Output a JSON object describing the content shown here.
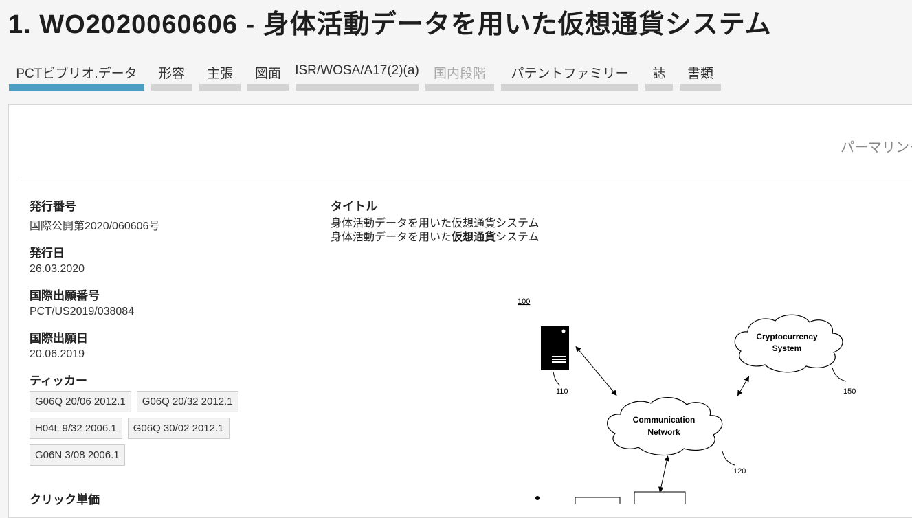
{
  "page": {
    "title": "1. WO2020060606 - 身体活動データを用いた仮想通貨システム"
  },
  "tabs": [
    {
      "label": "PCTビブリオ.データ",
      "state": "active"
    },
    {
      "label": "形容",
      "state": "normal"
    },
    {
      "label": "主張",
      "state": "normal"
    },
    {
      "label": "図面",
      "state": "normal"
    },
    {
      "label": "ISR/WOSA/A17(2)(a)",
      "state": "normal"
    },
    {
      "label": "国内段階",
      "state": "disabled"
    },
    {
      "label": "パテントファミリー",
      "state": "normal"
    },
    {
      "label": "誌",
      "state": "normal"
    },
    {
      "label": "書類",
      "state": "normal"
    }
  ],
  "permalink": "パーマリンク",
  "biblio": {
    "pub_number_label": "発行番号",
    "pub_number": "国際公開第2020/060606号",
    "pub_date_label": "発行日",
    "pub_date": "26.03.2020",
    "app_number_label": "国際出願番号",
    "app_number": "PCT/US2019/038084",
    "app_date_label": "国際出願日",
    "app_date": "20.06.2019",
    "ipc_label": "ティッカー",
    "ipc": [
      "G06Q 20/06 2012.1",
      "G06Q 20/32 2012.1",
      "H04L 9/32 2006.1",
      "G06Q 30/02 2012.1",
      "G06N 3/08 2006.1"
    ],
    "next_label": "クリック単価"
  },
  "title_section": {
    "label": "タイトル",
    "line1": "身体活動データを用いた仮想通貨システム",
    "line2_pre": "身体活動データを用いた",
    "line2_bold": "仮想通貨",
    "line2_post": "システム"
  },
  "drawing": {
    "ref_100": "100",
    "ref_110": "110",
    "ref_120": "120",
    "ref_150": "150",
    "crypto_line1": "Cryptocurrency",
    "crypto_line2": "System",
    "network_line1": "Communication",
    "network_line2": "Network"
  },
  "colors": {
    "active_tab": "#4a9fc1",
    "inactive_tab": "#d3d3d3"
  }
}
